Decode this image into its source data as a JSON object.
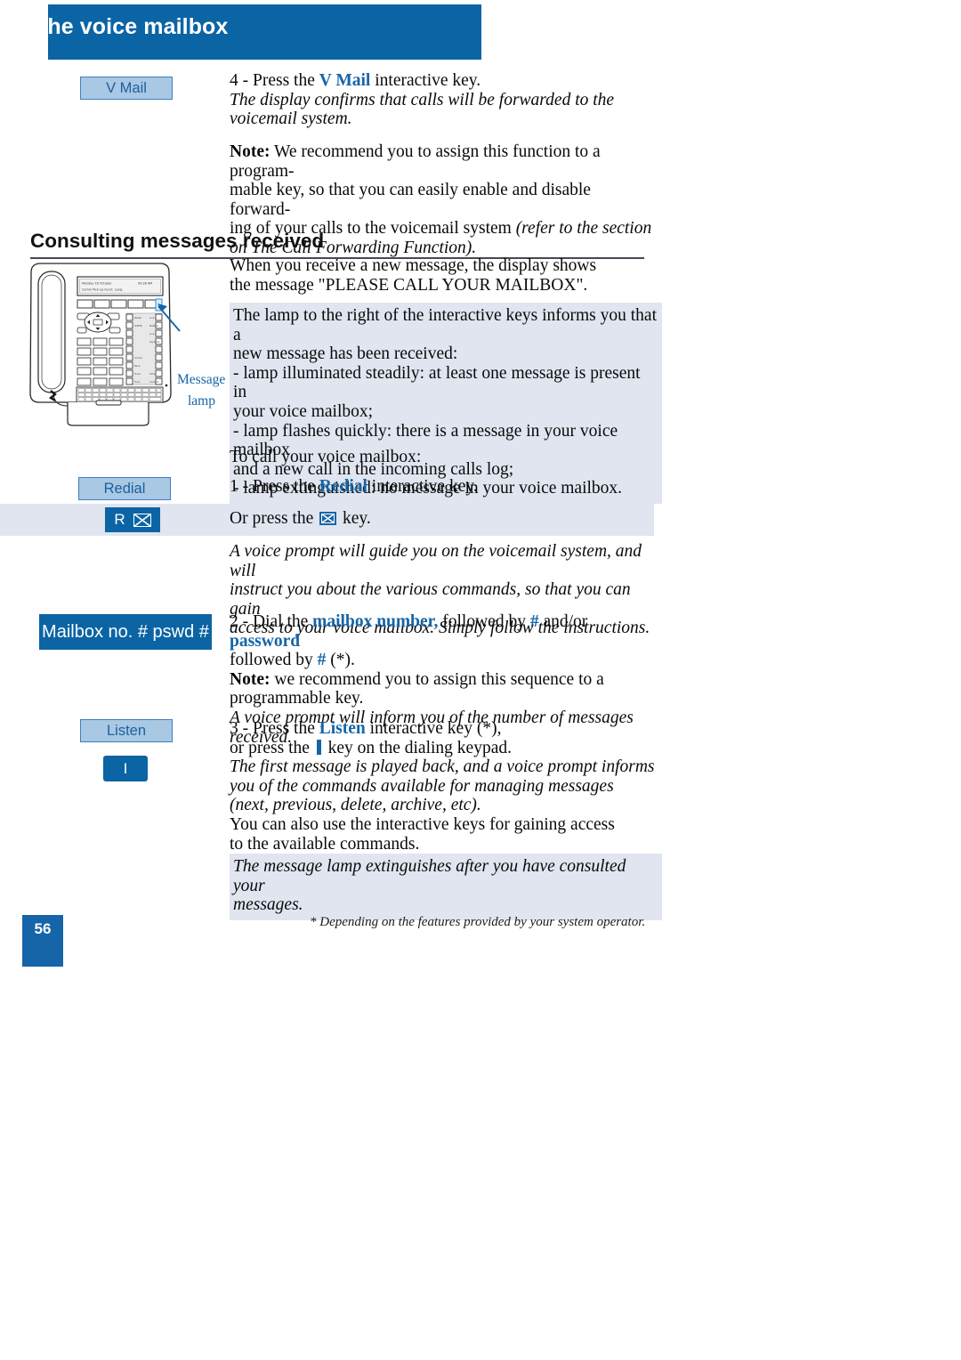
{
  "header": {
    "title": "The voice mailbox"
  },
  "keys": {
    "vmail_label": "V Mail",
    "redial_label": "Redial",
    "mailbox_label": "Mailbox no. # pswd #",
    "listen_label": "Listen",
    "r_key_letter": "R",
    "i_key_letter": "I",
    "envelope_icon": "envelope-icon",
    "bar_icon": "vertical-bar-key-icon"
  },
  "step4": {
    "line1_pre": "4 - Press the ",
    "line1_key": "V Mail",
    "line1_post": " interactive key.",
    "italic": "The display confirms that calls will be forwarded to the voicemail system.",
    "note_label": "Note:",
    "note_text": " We recommend you to assign this function to a program-",
    "note_line2": "mable key, so that you can easily enable and disable forward-",
    "note_line3_pre": "ing of your calls to the voicemail system ",
    "note_line3_it": "(refer to the section",
    "note_line4_it": "on The Call Forwarding Function)."
  },
  "section": {
    "heading": "Consulting messages received",
    "intro_line1": "When you receive a new message, the display shows",
    "intro_line2": "the message \"PLEASE CALL YOUR MAILBOX\".",
    "lamp_block": [
      "The lamp to the right of the interactive keys informs you that a",
      "new message has been received:",
      "- lamp illuminated steadily: at least one message is present in",
      "your voice mailbox;",
      "- lamp flashes quickly: there is a message in your voice mailbox",
      "and a new call in the incoming calls log;",
      "- lamp extinguished: no message in your voice mailbox."
    ],
    "to_call": "To call your voice mailbox:"
  },
  "step1": {
    "pre": "1 - Press the ",
    "key": "Redial",
    "post": " interactive key.",
    "or_pre": "Or press the ",
    "or_post": " key."
  },
  "voice_prompt_italic": [
    "A voice prompt will guide you on the voicemail system, and will",
    "instruct you about the various commands, so that you can gain",
    "access to your voice mailbox. Simply follow the instructions."
  ],
  "step2": {
    "pre": "2 - Dial the ",
    "k1": "mailbox number,",
    "mid": " followed by ",
    "hash1": "#",
    "mid2": " and/or ",
    "k2": "password",
    "line2_pre": "followed by ",
    "hash2": "#",
    "line2_post": " (*).",
    "note_label": "Note:",
    "note_text": " we recommend you to assign this sequence to a",
    "note_line2": "programmable key.",
    "italic": "A voice prompt will inform you of the number of messages received."
  },
  "step3": {
    "pre": "3 - Press the ",
    "key": "Listen",
    "post": " interactive key (*),",
    "line2_pre": "or press the ",
    "line2_post": " key on the dialing keypad.",
    "italic1": "The first message is played back, and a voice prompt informs",
    "italic2": "you of the commands available for managing messages",
    "italic3": "(next, previous, delete, archive, etc).",
    "line5": "You can also use the interactive keys for gaining access",
    "line6": "to the available commands."
  },
  "closing_note": [
    "The message lamp extinguishes after you have consulted your",
    "messages."
  ],
  "footnote": "* Depending on the features provided by your system operator.",
  "page_number": "56",
  "illustration": {
    "annotation_line1": "Message",
    "annotation_line2": "lamp",
    "display_line1_left": "Monday 16 October",
    "display_line1_right": "09:28 AM",
    "display_line2": "Comm  Pick-up  Funct.    Lang."
  },
  "colors": {
    "brand_blue": "#0b64a4",
    "accent_blue": "#1565a8",
    "light_key": "#a8c8e4",
    "shade": "#e0e5ef"
  }
}
